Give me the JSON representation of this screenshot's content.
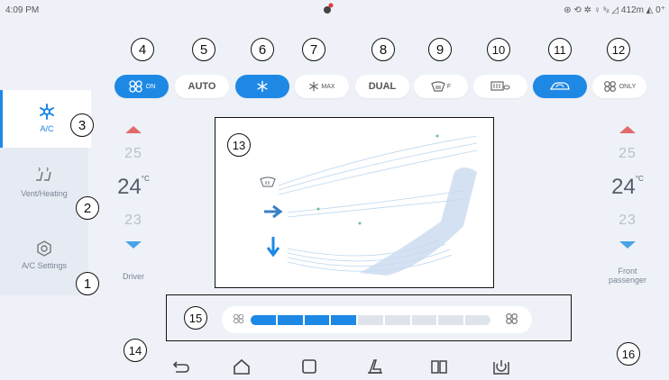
{
  "status": {
    "time": "4:09 PM",
    "right": "⊛ ⟲ ✲ ♀ ˢᵢₗ ◿ 412m ◭ 0⁺"
  },
  "sidebar": {
    "items": [
      {
        "label": "A/C",
        "icon": "snowflake-icon"
      },
      {
        "label": "Vent/Heating",
        "icon": "seat-heat-icon"
      },
      {
        "label": "A/C Settings",
        "icon": "settings-icon"
      }
    ]
  },
  "top_buttons": [
    {
      "label": "ON",
      "icon": "fan-icon"
    },
    {
      "label": "AUTO"
    },
    {
      "label": "",
      "icon": "snowflake-icon"
    },
    {
      "label": "MAX",
      "icon": "snowflake-max-icon"
    },
    {
      "label": "DUAL"
    },
    {
      "label": "F",
      "icon": "front-defrost-icon"
    },
    {
      "label": "",
      "icon": "rear-defrost-icon"
    },
    {
      "label": "",
      "icon": "recirculation-icon"
    },
    {
      "label": "ONLY",
      "icon": "fan-only-icon"
    }
  ],
  "driver": {
    "up_temp": "25",
    "temp": "24",
    "unit": "°C",
    "down_temp": "23",
    "label": "Driver"
  },
  "passenger": {
    "up_temp": "25",
    "temp": "24",
    "unit": "°C",
    "down_temp": "23",
    "label": "Front passenger"
  },
  "fan": {
    "level": 4,
    "max": 9
  },
  "callouts": [
    "1",
    "2",
    "3",
    "4",
    "5",
    "6",
    "7",
    "8",
    "9",
    "10",
    "11",
    "12",
    "13",
    "14",
    "15",
    "16"
  ],
  "colors": {
    "accent": "#1e88e5",
    "up_arrow": "#e36a6a",
    "down_arrow": "#4aa3e8"
  }
}
